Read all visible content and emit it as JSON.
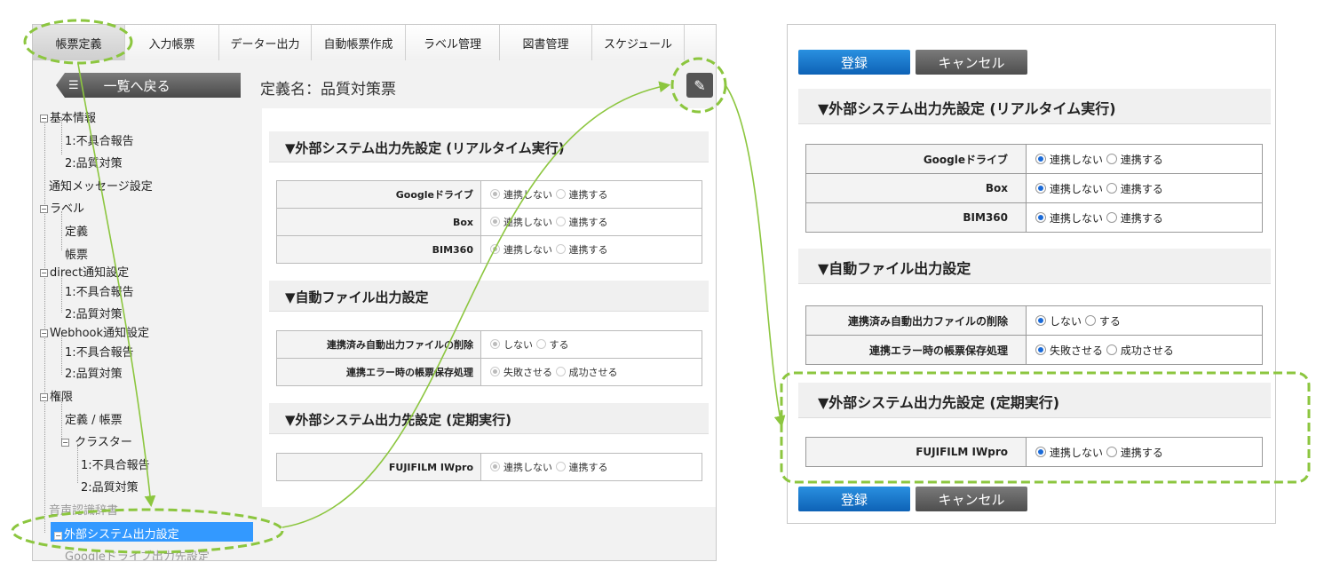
{
  "tabs": [
    "帳票定義",
    "入力帳票",
    "データー出力",
    "自動帳票作成",
    "ラベル管理",
    "図書管理",
    "スケジュール"
  ],
  "back_label": "一覧へ戻る",
  "back_icon": "list-icon",
  "definition_title": "定義名：品質対策票",
  "edit_icon": "edit-icon",
  "tree": {
    "basic": "基本情報",
    "basic_1": "1:不具合報告",
    "basic_2": "2:品質対策",
    "notify": "通知メッセージ設定",
    "label": "ラベル",
    "label_def": "定義",
    "label_form": "帳票",
    "direct": "direct通知設定",
    "direct_1": "1:不具合報告",
    "direct_2": "2:品質対策",
    "webhook": "Webhook通知設定",
    "webhook_1": "1:不具合報告",
    "webhook_2": "2:品質対策",
    "perm": "権限",
    "perm_def": "定義 / 帳票",
    "cluster": "クラスター",
    "cluster_1": "1:不具合報告",
    "cluster_2": "2:品質対策",
    "voice": "音声認識辞書",
    "external": "外部システム出力設定",
    "gdrive_setting": "Googleドライブ出力先設定"
  },
  "sections": {
    "realtime": "▼外部システム出力先設定 (リアルタイム実行)",
    "auto_file": "▼自動ファイル出力設定",
    "periodic": "▼外部システム出力先設定 (定期実行)"
  },
  "rows": {
    "gdrive": "Googleドライブ",
    "box": "Box",
    "bim": "BIM360",
    "delete_files": "連携済み自動出力ファイルの削除",
    "error_handling": "連携エラー時の帳票保存処理",
    "iwpro": "FUJIFILM IWpro"
  },
  "options": {
    "no_link": "連携しない",
    "link": "連携する",
    "no": "しない",
    "yes": "する",
    "fail": "失敗させる",
    "succeed": "成功させる"
  },
  "buttons": {
    "register": "登録",
    "cancel": "キャンセル"
  },
  "colors": {
    "highlight": "#8cc63f",
    "selected": "#3399ff",
    "primary": "#1a74c8"
  }
}
